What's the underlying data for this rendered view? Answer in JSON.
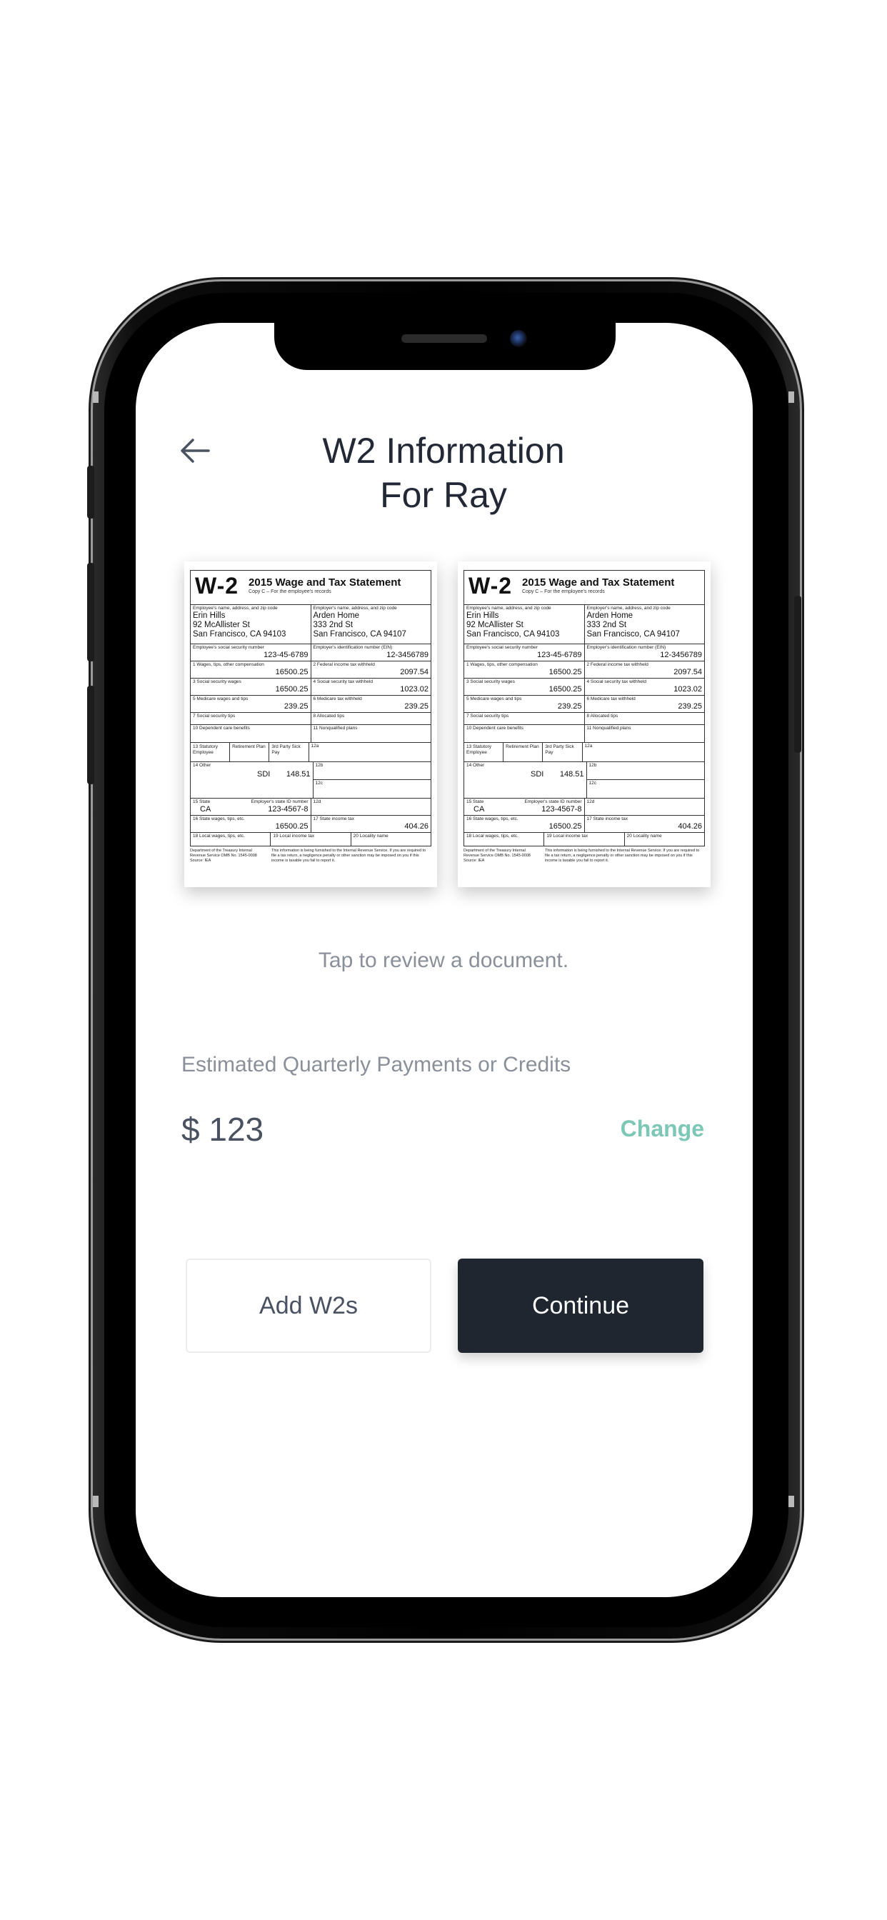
{
  "header": {
    "title_line1": "W2 Information",
    "title_line2": "For Ray"
  },
  "documents": [
    {
      "form": "W-2",
      "heading": "2015 Wage and Tax Statement",
      "copy_note": "Copy C – For the employee's records",
      "employee_addr_label": "Employee's name, address, and zip code",
      "employee_name": "Erin Hills",
      "employee_street": "92 McAllister St",
      "employee_city": "San Francisco, CA 94103",
      "employer_addr_label": "Employer's name, address, and zip code",
      "employer_name": "Arden Home",
      "employer_street": "333 2nd St",
      "employer_city": "San Francisco, CA 94107",
      "ssn_label": "Employee's social security number",
      "ssn": "123-45-6789",
      "ein_label": "Employer's identification number (EIN)",
      "ein": "12-3456789",
      "box1_label": "1  Wages, tips, other compensation",
      "box1": "16500.25",
      "box2_label": "2  Federal income tax withheld",
      "box2": "2097.54",
      "box3_label": "3  Social security wages",
      "box3": "16500.25",
      "box4_label": "4  Social security tax withheld",
      "box4": "1023.02",
      "box5_label": "5  Medicare wages and tips",
      "box5": "239.25",
      "box6_label": "6  Medicare tax withheld",
      "box6": "239.25",
      "box7_label": "7  Social security tips",
      "box8_label": "8  Allocated tips",
      "box10_label": "10  Dependent care benefits",
      "box11_label": "11  Nonqualified plans",
      "box13_a": "13  Statutory Employee",
      "box13_b": "Retirement Plan",
      "box13_c": "3rd Party Sick Pay",
      "box12a": "12a",
      "box12b": "12b",
      "box12c": "12c",
      "box12d": "12d",
      "box14_label": "14  Other",
      "box14_code": "SDI",
      "box14_value": "148.51",
      "box15_label": "15  State",
      "box15_id_label": "Employer's state ID number",
      "box15_state": "CA",
      "box15_id": "123-4567-8",
      "box16_label": "16  State wages, tips, etc.",
      "box16": "16500.25",
      "box17_label": "17  State income tax",
      "box17": "404.26",
      "box18_label": "18  Local wages, tips, etc.",
      "box19_label": "19  Local income tax",
      "box20_label": "20  Locality name",
      "footer_left": "Department of the Treasury Internal Revenue Service OMB No. 1545-0008  Source: IEA",
      "footer_right": "This information is being furnished to the Internal Revenue Service. If you are required to file a tax return, a negligence penalty or other sanction may be imposed on you if this income is taxable you fail to report it."
    },
    {
      "form": "W-2",
      "heading": "2015 Wage and Tax Statement",
      "copy_note": "Copy C – For the employee's records",
      "employee_addr_label": "Employee's name, address, and zip code",
      "employee_name": "Erin Hills",
      "employee_street": "92 McAllister St",
      "employee_city": "San Francisco, CA 94103",
      "employer_addr_label": "Employer's name, address, and zip code",
      "employer_name": "Arden Home",
      "employer_street": "333 2nd St",
      "employer_city": "San Francisco, CA 94107",
      "ssn_label": "Employee's social security number",
      "ssn": "123-45-6789",
      "ein_label": "Employer's identification number (EIN)",
      "ein": "12-3456789",
      "box1_label": "1  Wages, tips, other compensation",
      "box1": "16500.25",
      "box2_label": "2  Federal income tax withheld",
      "box2": "2097.54",
      "box3_label": "3  Social security wages",
      "box3": "16500.25",
      "box4_label": "4  Social security tax withheld",
      "box4": "1023.02",
      "box5_label": "5  Medicare wages and tips",
      "box5": "239.25",
      "box6_label": "6  Medicare tax withheld",
      "box6": "239.25",
      "box7_label": "7  Social security tips",
      "box8_label": "8  Allocated tips",
      "box10_label": "10  Dependent care benefits",
      "box11_label": "11  Nonqualified plans",
      "box13_a": "13  Statutory Employee",
      "box13_b": "Retirement Plan",
      "box13_c": "3rd Party Sick Pay",
      "box12a": "12a",
      "box12b": "12b",
      "box12c": "12c",
      "box12d": "12d",
      "box14_label": "14  Other",
      "box14_code": "SDI",
      "box14_value": "148.51",
      "box15_label": "15  State",
      "box15_id_label": "Employer's state ID number",
      "box15_state": "CA",
      "box15_id": "123-4567-8",
      "box16_label": "16  State wages, tips, etc.",
      "box16": "16500.25",
      "box17_label": "17  State income tax",
      "box17": "404.26",
      "box18_label": "18  Local wages, tips, etc.",
      "box19_label": "19  Local income tax",
      "box20_label": "20  Locality name",
      "footer_left": "Department of the Treasury Internal Revenue Service OMB No. 1545-0008  Source: IEA",
      "footer_right": "This information is being furnished to the Internal Revenue Service. If you are required to file a tax return, a negligence penalty or other sanction may be imposed on you if this income is taxable you fail to report it."
    }
  ],
  "hint": "Tap to review a document.",
  "estimate": {
    "label": "Estimated Quarterly Payments or Credits",
    "amount": "$ 123",
    "change_label": "Change"
  },
  "actions": {
    "add_label": "Add W2s",
    "continue_label": "Continue"
  },
  "colors": {
    "accent": "#7cc7b5",
    "primary_button": "#1f2630",
    "title_text": "#222836",
    "muted_text": "#8a909a"
  },
  "icons": {
    "back": "arrow-left-icon"
  }
}
